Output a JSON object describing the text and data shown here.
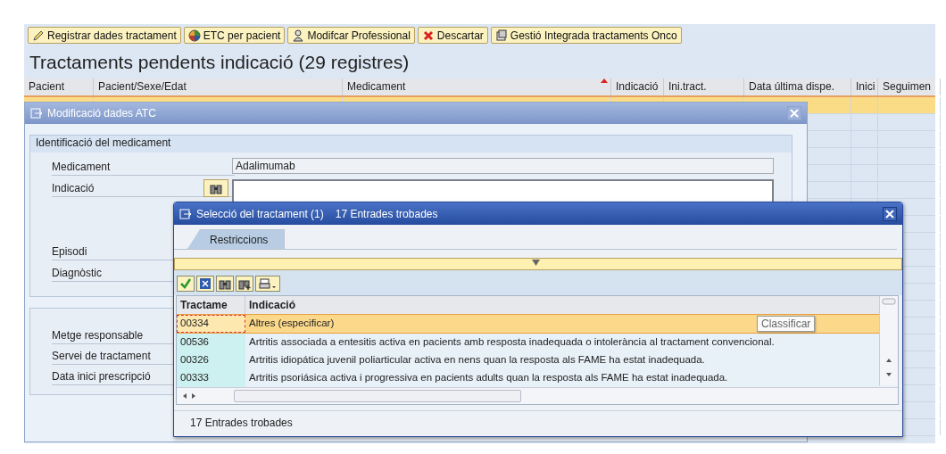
{
  "toolbar": [
    {
      "label": "Registrar dades tractament",
      "kind": "edit"
    },
    {
      "label": "ETC per pacient",
      "kind": "chart"
    },
    {
      "label": "Modifcar Professional",
      "kind": "person"
    },
    {
      "label": "Descartar",
      "kind": "discard"
    },
    {
      "label": "Gestió Integrada tractaments Onco",
      "kind": "manage"
    }
  ],
  "title": "Tractaments pendents indicació (29 registres)",
  "table": {
    "columns": [
      {
        "label": "Pacient",
        "sorted": false
      },
      {
        "label": "Pacient/Sexe/Edat",
        "sorted": false
      },
      {
        "label": "Medicament",
        "sorted": true
      },
      {
        "label": "Indicació",
        "sorted": false
      },
      {
        "label": "Ini.tract.",
        "sorted": false
      },
      {
        "label": "Data última dispe.",
        "sorted": false
      },
      {
        "label": "Inici",
        "sorted": false
      },
      {
        "label": "Seguimen",
        "sorted": false
      }
    ],
    "rows": [
      {
        "selected": true
      },
      {
        "selected": false
      },
      {
        "selected": false
      },
      {
        "selected": false
      },
      {
        "selected": false
      },
      {
        "selected": false
      },
      {
        "selected": false
      },
      {
        "selected": false
      },
      {
        "selected": false
      },
      {
        "selected": false
      },
      {
        "selected": false
      },
      {
        "selected": false
      },
      {
        "selected": false
      },
      {
        "selected": false
      },
      {
        "selected": false
      },
      {
        "selected": false
      },
      {
        "selected": false
      },
      {
        "selected": false
      },
      {
        "selected": false
      },
      {
        "selected": false
      }
    ]
  },
  "dialog": {
    "title": "Modificació dades ATC",
    "group_title": "Identificació del medicament",
    "fields": [
      {
        "kind": "text",
        "label": "Medicament",
        "value": "Adalimumab"
      },
      {
        "kind": "search",
        "label": "Indicació"
      },
      {
        "kind": "label",
        "label": "Episodi"
      },
      {
        "kind": "label",
        "label": "Diagnòstic"
      }
    ],
    "fields_2": [
      {
        "label": "Metge responsable"
      },
      {
        "label": "Servei de tractament"
      },
      {
        "label": "Data inici prescripció"
      }
    ]
  },
  "popup": {
    "title": "Selecció del tractament (1)",
    "count": "17 Entrades trobades",
    "tabs": [
      {
        "label": "Restriccions",
        "selected": true
      }
    ],
    "columns": [
      "Tractame",
      "Indicació"
    ],
    "rows": [
      {
        "code": "00334",
        "text": "Altres (especificar)",
        "selected": true
      },
      {
        "code": "00536",
        "text": "Artritis associada a entesitis activa en pacients amb resposta inadequada o intolerància al tractament convencional.",
        "selected": false
      },
      {
        "code": "00326",
        "text": "Artritis idiopática juvenil poliarticular activa en nens quan la resposta als FAME ha estat inadequada.",
        "selected": false
      },
      {
        "code": "00333",
        "text": "Artritis psoriásica activa i progressiva en pacients adults quan la resposta als FAME ha estat inadequada.",
        "selected": false
      }
    ],
    "tooltip": "Classificar",
    "status": "17 Entrades trobades"
  }
}
